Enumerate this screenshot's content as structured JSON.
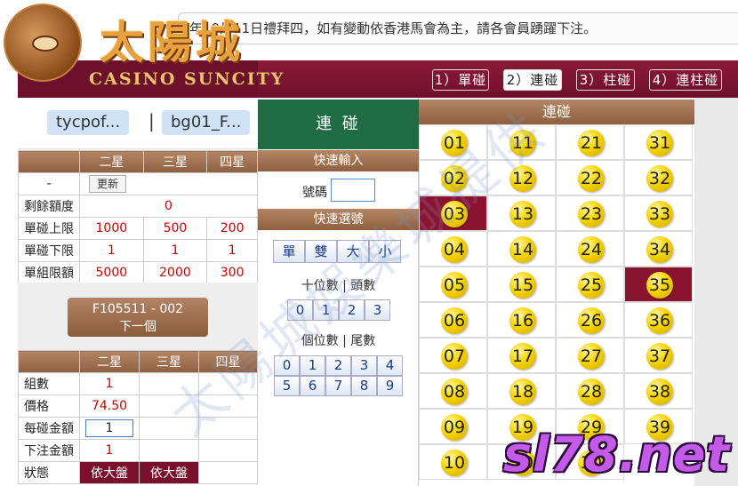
{
  "marquee": "年10月11日禮拜四，如有變動依香港馬會為主，請各會員踴躍下注。",
  "logo": {
    "cn": "太陽城",
    "en": "CASINO SUNCITY"
  },
  "tabs": [
    "1）單碰",
    "2）連碰",
    "3）柱碰",
    "4）連柱碰"
  ],
  "active_tab": 1,
  "users": {
    "left": "tycpof...",
    "sep": "|",
    "right": "bg01_F..."
  },
  "limits": {
    "headers": [
      "",
      "二星",
      "三星",
      "四星"
    ],
    "update_row": {
      "label": "-",
      "button": "更新"
    },
    "rows": [
      {
        "label": "剩餘額度",
        "values": [
          "0"
        ]
      },
      {
        "label": "單碰上限",
        "values": [
          "1000",
          "500",
          "200"
        ]
      },
      {
        "label": "單碰下限",
        "values": [
          "1",
          "1",
          "1"
        ]
      },
      {
        "label": "單組限額",
        "values": [
          "5000",
          "2000",
          "300"
        ]
      }
    ]
  },
  "next": {
    "line1": "F105511 - 002",
    "line2": "下一個"
  },
  "bet": {
    "headers": [
      "",
      "二星",
      "三星",
      "四星"
    ],
    "rows": [
      {
        "label": "組數",
        "value": "1"
      },
      {
        "label": "價格",
        "value": "74.50"
      },
      {
        "label": "每碰金額",
        "value": "1"
      },
      {
        "label": "下注金額",
        "value": "1"
      }
    ],
    "status_label": "狀態",
    "status_values": [
      "依大盤",
      "依大盤"
    ]
  },
  "middle": {
    "title": "連 碰",
    "quick_input": "快速輸入",
    "number_label": "號碼",
    "quick_select": "快速選號",
    "size_buttons": [
      "單",
      "雙",
      "大",
      "小"
    ],
    "tens_label": "十位數 | 頭數",
    "tens_buttons": [
      "0",
      "1",
      "2",
      "3"
    ],
    "units_label": "個位數 | 尾數",
    "units_buttons_row1": [
      "0",
      "1",
      "2",
      "3",
      "4"
    ],
    "units_buttons_row2": [
      "5",
      "6",
      "7",
      "8",
      "9"
    ]
  },
  "grid": {
    "title": "連碰",
    "numbers": [
      "01",
      "02",
      "03",
      "04",
      "05",
      "06",
      "07",
      "08",
      "09",
      "10",
      "11",
      "12",
      "13",
      "14",
      "15",
      "16",
      "17",
      "18",
      "19",
      "20",
      "21",
      "22",
      "23",
      "24",
      "25",
      "26",
      "27",
      "28",
      "29",
      "30",
      "31",
      "32",
      "33",
      "34",
      "35",
      "36",
      "37",
      "38",
      "39"
    ],
    "selected": [
      "03",
      "35"
    ]
  },
  "watermark": "太陽城娛樂城提供",
  "site_watermark": "sl78.net"
}
